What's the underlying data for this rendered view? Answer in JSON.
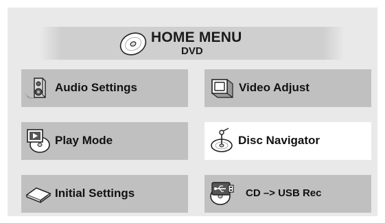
{
  "header": {
    "title": "HOME MENU",
    "subtitle": "DVD",
    "icon": "disc-icon"
  },
  "menu": {
    "items": [
      {
        "label": "Audio Settings",
        "icon": "speaker-icon",
        "selected": false
      },
      {
        "label": "Video Adjust",
        "icon": "monitor-icon",
        "selected": false
      },
      {
        "label": "Play Mode",
        "icon": "play-disc-icon",
        "selected": false
      },
      {
        "label": "Disc Navigator",
        "icon": "disc-navigator-icon",
        "selected": true
      },
      {
        "label": "Initial Settings",
        "icon": "settings-box-icon",
        "selected": false
      },
      {
        "label": "CD –> USB Rec",
        "icon": "cd-usb-icon",
        "selected": false
      }
    ]
  },
  "colors": {
    "panel_bg": "#e9e9e9",
    "item_bg": "#c0c0c0",
    "selected_bg": "#ffffff",
    "text": "#111111"
  }
}
